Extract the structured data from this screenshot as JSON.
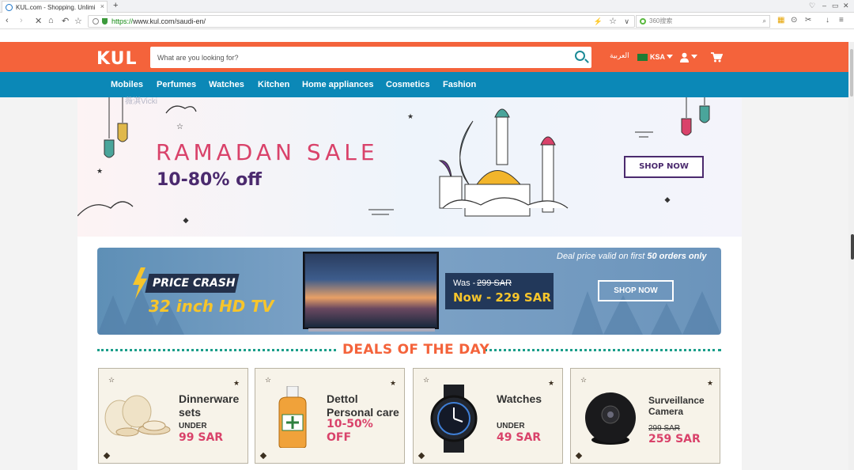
{
  "browser": {
    "tab_title": "KUL.com - Shopping. Unlimi",
    "tab_close": "×",
    "new_tab": "+",
    "url_scheme": "https://",
    "url_rest": "www.kul.com/saudi-en/",
    "search_placeholder": "360搜索",
    "win_controls": [
      "♡",
      "–",
      "▭",
      "✕"
    ]
  },
  "header": {
    "logo": "KUL",
    "search_placeholder": "What are you looking for?",
    "language_link": "العربية",
    "country": "KSA",
    "accent_orange": "#f4633b",
    "accent_blue": "#0b88b7"
  },
  "nav": {
    "categories": [
      "Mobiles",
      "Perfumes",
      "Watches",
      "Kitchen",
      "Home appliances",
      "Cosmetics",
      "Fashion"
    ]
  },
  "hero": {
    "title": "RAMADAN SALE",
    "subtitle": "10-80% off",
    "button": "SHOP NOW"
  },
  "promo": {
    "badge": "PRICE CRASH",
    "product": "32 inch HD TV",
    "was_label": "Was -",
    "was_price": "299 SAR",
    "now_price": "Now - 229 SAR",
    "note_prefix": "Deal price valid on first ",
    "note_bold": "50 orders only",
    "button": "SHOP NOW"
  },
  "deals": {
    "title": "DEALS OF THE DAY",
    "cards": [
      {
        "name_line1": "Dinnerware",
        "name_line2": "sets",
        "under": "UNDER",
        "price": "99 SAR"
      },
      {
        "name_line1": "Dettol",
        "name_line2": "Personal care",
        "discount": "10-50%",
        "discount_suffix": "OFF"
      },
      {
        "name_line1": "Watches",
        "under": "UNDER",
        "price": "49 SAR"
      },
      {
        "name_line1": "Surveillance",
        "name_line2": "Camera",
        "old_price": "299 SAR",
        "price": "259 SAR"
      }
    ]
  },
  "watermark": "薇淇Vicki"
}
